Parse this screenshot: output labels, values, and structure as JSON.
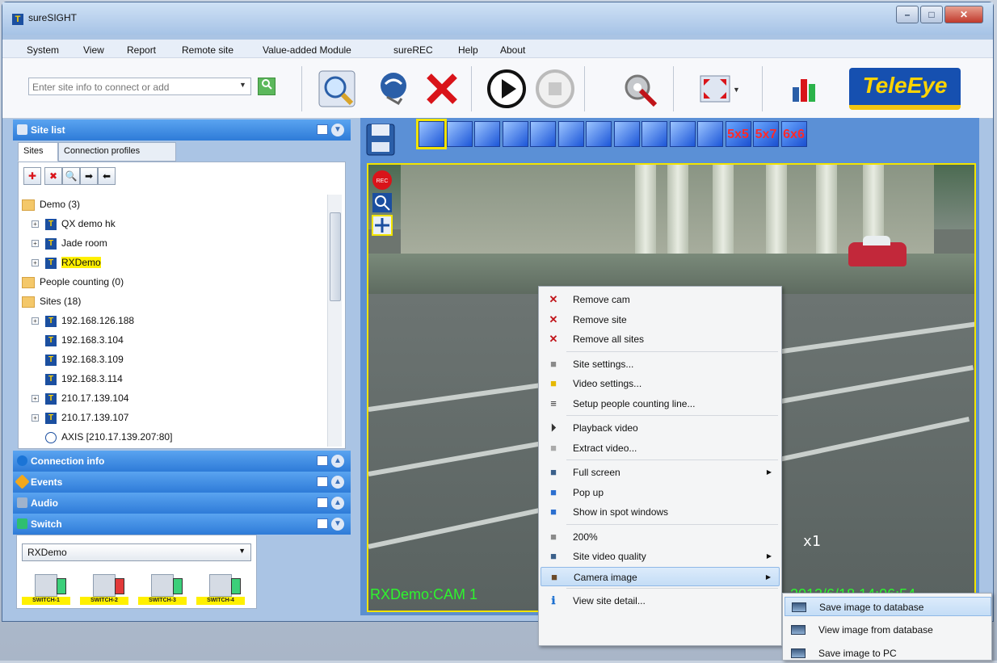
{
  "window": {
    "title": "sureSIGHT",
    "app_icon": "T",
    "min_label": "–",
    "max_label": "□",
    "close_label": "✕"
  },
  "menu": [
    "System",
    "View",
    "Report",
    "Remote site",
    "Value-added Module",
    "sureREC",
    "Help",
    "About"
  ],
  "toolbar": {
    "search_placeholder": "Enter site info to connect or add",
    "search_icon": "search-icon",
    "buttons": [
      "find-icon",
      "connect-icon",
      "disconnect-icon",
      "play-icon",
      "stop-icon",
      "settings-icon",
      "fullscreen-icon",
      "report-icon"
    ],
    "logo": "TeleEye"
  },
  "site_list": {
    "header": "Site list",
    "tabs": [
      "Sites",
      "Connection profiles"
    ],
    "tools": [
      "add-site-icon",
      "delete-site-icon",
      "find-site-icon",
      "forward-icon",
      "back-icon"
    ],
    "tree": [
      {
        "label": "Demo (3)",
        "type": "folder",
        "indent": 0
      },
      {
        "label": "QX demo hk",
        "type": "device",
        "indent": 1,
        "exp": "+"
      },
      {
        "label": "Jade room",
        "type": "device",
        "indent": 1,
        "exp": "+"
      },
      {
        "label": "RXDemo",
        "type": "device",
        "indent": 1,
        "exp": "+",
        "highlight": true
      },
      {
        "label": "People counting (0)",
        "type": "folder",
        "indent": 0
      },
      {
        "label": "Sites (18)",
        "type": "folder",
        "indent": 0
      },
      {
        "label": "192.168.126.188",
        "type": "device",
        "indent": 1,
        "exp": "+"
      },
      {
        "label": "192.168.3.104",
        "type": "device",
        "indent": 1,
        "exp": ""
      },
      {
        "label": "192.168.3.109",
        "type": "device",
        "indent": 1,
        "exp": ""
      },
      {
        "label": "192.168.3.114",
        "type": "device",
        "indent": 1,
        "exp": ""
      },
      {
        "label": "210.17.139.104",
        "type": "device",
        "indent": 1,
        "exp": "+"
      },
      {
        "label": "210.17.139.107",
        "type": "device",
        "indent": 1,
        "exp": "+"
      },
      {
        "label": "AXIS [210.17.139.207:80]",
        "type": "camera",
        "indent": 1,
        "exp": ""
      }
    ]
  },
  "panels": [
    {
      "label": "Connection info",
      "icon": "info-icon",
      "color": "#1b74d6"
    },
    {
      "label": "Events",
      "icon": "warning-icon",
      "color": "#f3a81b"
    },
    {
      "label": "Audio",
      "icon": "speaker-icon",
      "color": "#9fb3cc"
    },
    {
      "label": "Switch",
      "icon": "switch-icon",
      "color": "#2fbf6f"
    }
  ],
  "switch": {
    "selected": "RXDemo",
    "switches": [
      {
        "label": "SWITCH-1",
        "state": "off"
      },
      {
        "label": "SWITCH-2",
        "state": "on"
      },
      {
        "label": "SWITCH-3",
        "state": "off"
      },
      {
        "label": "SWITCH-4",
        "state": "off"
      }
    ]
  },
  "layouts": [
    "1x1",
    "2x2",
    "1+5",
    "1+7",
    "3x3a",
    "3x3b",
    "4x4",
    "4x4b",
    "1+12",
    "5x4",
    "6x4",
    "5x5",
    "5x7",
    "6x6"
  ],
  "video": {
    "cam_label": "RXDemo:CAM 1",
    "timestamp": "2013/6/18 14:06:54",
    "zoom": "x1",
    "rec_label": "REC"
  },
  "context_menu": [
    {
      "label": "Remove cam",
      "icon": "remove-icon",
      "icon_color": "#c0141a"
    },
    {
      "label": "Remove site",
      "icon": "remove-icon",
      "icon_color": "#c0141a"
    },
    {
      "label": "Remove all sites",
      "icon": "remove-icon",
      "icon_color": "#c0141a",
      "sep_after": true
    },
    {
      "label": "Site settings...",
      "icon": "settings-icon",
      "icon_color": "#8a8a8a"
    },
    {
      "label": "Video settings...",
      "icon": "video-settings-icon",
      "icon_color": "#e6b800"
    },
    {
      "label": "Setup people counting line...",
      "icon": "list-icon",
      "icon_color": "#333",
      "sep_after": true
    },
    {
      "label": "Playback video",
      "icon": "play-icon",
      "icon_color": "#333"
    },
    {
      "label": "Extract video...",
      "icon": "extract-icon",
      "icon_color": "#aaa",
      "sep_after": true
    },
    {
      "label": "Full screen",
      "icon": "fullscreen-icon",
      "icon_color": "#3a5f8a",
      "submenu": true
    },
    {
      "label": "Pop up",
      "icon": "popup-icon",
      "icon_color": "#2b6fd0"
    },
    {
      "label": "Show in spot windows",
      "icon": "spot-icon",
      "icon_color": "#2b6fd0",
      "sep_after": true
    },
    {
      "label": "200%",
      "icon": "zoom-icon",
      "icon_color": "#8a8a8a"
    },
    {
      "label": "Site video quality",
      "icon": "quality-icon",
      "icon_color": "#3a5f8a",
      "submenu": true
    },
    {
      "label": "Camera image",
      "icon": "camera-image-icon",
      "icon_color": "#6b4a2a",
      "submenu": true,
      "selected": true,
      "sep_after": true
    },
    {
      "label": "View site detail...",
      "icon": "info-icon",
      "icon_color": "#1b6fd0"
    }
  ],
  "submenu": [
    {
      "label": "Save image to database",
      "selected": true
    },
    {
      "label": "View image from database",
      "selected": false
    },
    {
      "label": "Save image to PC",
      "selected": false
    }
  ]
}
